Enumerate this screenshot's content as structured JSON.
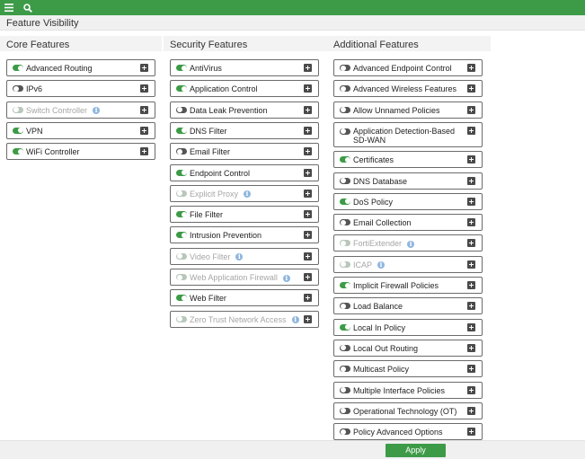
{
  "header": {
    "title": "Feature Visibility"
  },
  "columns": {
    "core": {
      "title": "Core Features",
      "items": [
        {
          "label": "Advanced Routing",
          "state": "on"
        },
        {
          "label": "IPv6",
          "state": "off"
        },
        {
          "label": "Switch Controller",
          "state": "disabled",
          "info": true
        },
        {
          "label": "VPN",
          "state": "on"
        },
        {
          "label": "WiFi Controller",
          "state": "on"
        }
      ]
    },
    "security": {
      "title": "Security Features",
      "items": [
        {
          "label": "AntiVirus",
          "state": "on"
        },
        {
          "label": "Application Control",
          "state": "on"
        },
        {
          "label": "Data Leak Prevention",
          "state": "off"
        },
        {
          "label": "DNS Filter",
          "state": "on"
        },
        {
          "label": "Email Filter",
          "state": "off"
        },
        {
          "label": "Endpoint Control",
          "state": "on"
        },
        {
          "label": "Explicit Proxy",
          "state": "disabled",
          "info": true
        },
        {
          "label": "File Filter",
          "state": "on"
        },
        {
          "label": "Intrusion Prevention",
          "state": "on"
        },
        {
          "label": "Video Filter",
          "state": "disabled",
          "info": true
        },
        {
          "label": "Web Application Firewall",
          "state": "disabled",
          "info": true
        },
        {
          "label": "Web Filter",
          "state": "on"
        },
        {
          "label": "Zero Trust Network Access",
          "state": "disabled",
          "info": true
        }
      ]
    },
    "additional": {
      "title": "Additional Features",
      "items": [
        {
          "label": "Advanced Endpoint Control",
          "state": "off"
        },
        {
          "label": "Advanced Wireless Features",
          "state": "off"
        },
        {
          "label": "Allow Unnamed Policies",
          "state": "off"
        },
        {
          "label": "Application Detection-Based SD-WAN",
          "state": "off",
          "tall": true
        },
        {
          "label": "Certificates",
          "state": "on"
        },
        {
          "label": "DNS Database",
          "state": "off"
        },
        {
          "label": "DoS Policy",
          "state": "on"
        },
        {
          "label": "Email Collection",
          "state": "off"
        },
        {
          "label": "FortiExtender",
          "state": "disabled",
          "info": true
        },
        {
          "label": "ICAP",
          "state": "disabled",
          "info": true
        },
        {
          "label": "Implicit Firewall Policies",
          "state": "on"
        },
        {
          "label": "Load Balance",
          "state": "off"
        },
        {
          "label": "Local In Policy",
          "state": "on"
        },
        {
          "label": "Local Out Routing",
          "state": "off"
        },
        {
          "label": "Multicast Policy",
          "state": "off"
        },
        {
          "label": "Multiple Interface Policies",
          "state": "off"
        },
        {
          "label": "Operational Technology (OT)",
          "state": "off"
        },
        {
          "label": "Policy Advanced Options",
          "state": "off"
        }
      ]
    }
  },
  "footer": {
    "apply_label": "Apply"
  },
  "icons": {
    "menu": "hamburger-menu-icon",
    "search": "search-icon",
    "info": "info-icon",
    "expand": "plus-box-icon"
  },
  "colors": {
    "accent": "#3d9b47",
    "toggle_off": "#555555",
    "info": "#8fb6df"
  }
}
